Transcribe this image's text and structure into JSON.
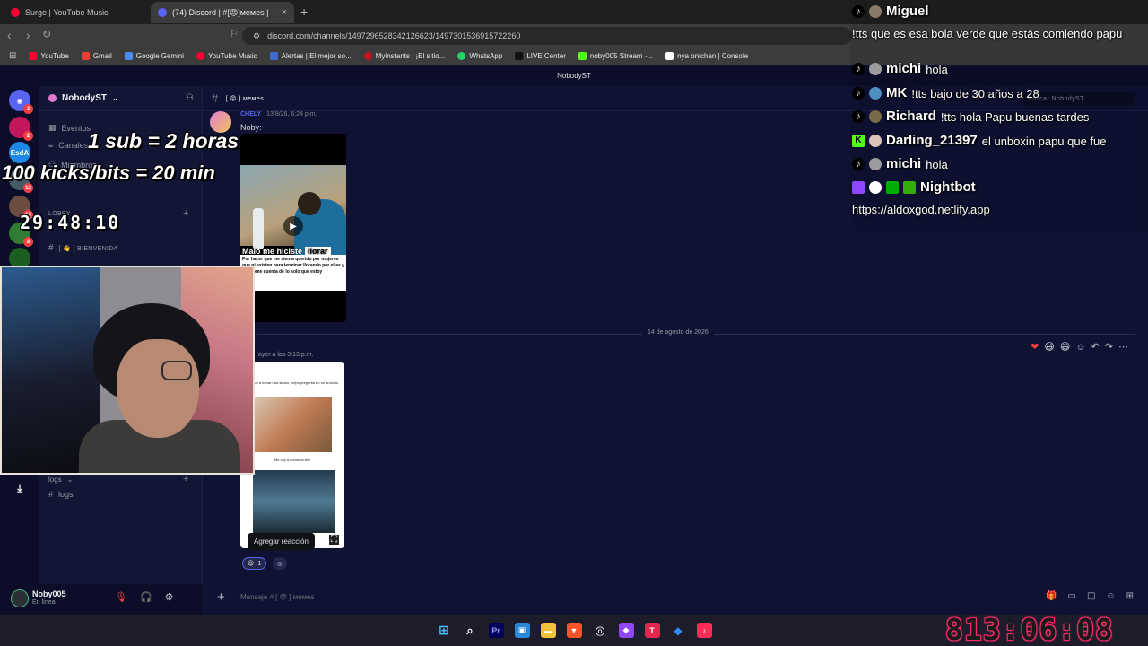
{
  "browser": {
    "tabs": [
      {
        "title": "Surge | YouTube Music",
        "color": "#ff0033"
      },
      {
        "title": "(74) Discord | #[😡]мемеs | Nob",
        "color": "#5865f2"
      }
    ],
    "url": "discord.com/channels/1497296528342126623/1497301536915722260",
    "bookmarks": [
      {
        "label": "YouTube",
        "color": "#ff0033"
      },
      {
        "label": "Gmail",
        "color": "#ea4335"
      },
      {
        "label": "Google Gemini",
        "color": "#4e8cf5"
      },
      {
        "label": "YouTube Music",
        "color": "#ff0033"
      },
      {
        "label": "Alertas | El mejor so...",
        "color": "#3f6bd6"
      },
      {
        "label": "Myinstants | ¡El sitio...",
        "color": "#c4161c"
      },
      {
        "label": "WhatsApp",
        "color": "#25d366"
      },
      {
        "label": "LIVE Center",
        "color": "#111111"
      },
      {
        "label": "noby005 Stream -...",
        "color": "#53fc18"
      },
      {
        "label": "nya onichan | Console",
        "color": "#ffffff"
      }
    ]
  },
  "discord": {
    "window_title": "NobodyST",
    "server_name": "NobodyST",
    "channels": {
      "eventos": "Eventos",
      "canales": "Canales",
      "miembros": "Miembros",
      "lobby": "LOBBY",
      "bienvenida": "[ 👋 ] BIENVENIDA",
      "logs_category": "logs",
      "logs": "logs"
    },
    "channel_header": "[ 😡 ] мемеs",
    "search_placeholder": "Buscar NobodyST",
    "message1": {
      "author": "CHELY",
      "time": "13/8/26, 6:24 p.m.",
      "text": "Noby:"
    },
    "video": {
      "caption": "Malo me hiciste",
      "caption_tag": "llorar",
      "subtext": "Por hacer que me sienta querido por mujeres que ni existen para terminar llorando por ellas y dandome cuenta de lo solo que estoy"
    },
    "date_separator": "14 de agosto de 2026",
    "message2": {
      "time": "ayer a las 3:13 p.m."
    },
    "meme": {
      "top_text": "Me voy a tomar una siesta, mejor pregunta en un anuncio",
      "mid_text": "Me voy a comer la tele"
    },
    "tooltip": "Agregar reacción",
    "reaction": {
      "emoji": "😆",
      "count": "1"
    },
    "user": {
      "name": "Noby005",
      "status": "En línea"
    },
    "composer_placeholder": "Mensaje # [ 😡 ] мемеs"
  },
  "stream_overlay": {
    "line1": "1 sub = 2 horas",
    "line2": "100 kicks/bits = 20 min",
    "timer": "29:48:10",
    "big_timer": "813:06:08"
  },
  "chat": [
    {
      "name": "Miguel",
      "message": "",
      "platform": "tiktok"
    },
    {
      "name": "",
      "message": "!tts que es esa bola verde que estás comiendo papu",
      "platform": ""
    },
    {
      "name": "michi",
      "message": "hola",
      "platform": "tiktok"
    },
    {
      "name": "MK",
      "message": "!tts bajo de 30 años a 28",
      "platform": "tiktok"
    },
    {
      "name": "Richard",
      "message": "!tts hola Papu buenas tardes",
      "platform": "tiktok"
    },
    {
      "name": "Darling_21397",
      "message": "el unboxin papu que fue",
      "platform": "kick"
    },
    {
      "name": "michi",
      "message": "hola",
      "platform": "tiktok"
    },
    {
      "name": "Nightbot",
      "message": "",
      "platform": "twitch"
    },
    {
      "name": "",
      "message": "https://aldoxgod.netlify.app",
      "platform": ""
    }
  ],
  "colors": {
    "accent": "#5865f2",
    "kick": "#53fc18",
    "twitch": "#9146ff",
    "tiktok": "#000000"
  }
}
